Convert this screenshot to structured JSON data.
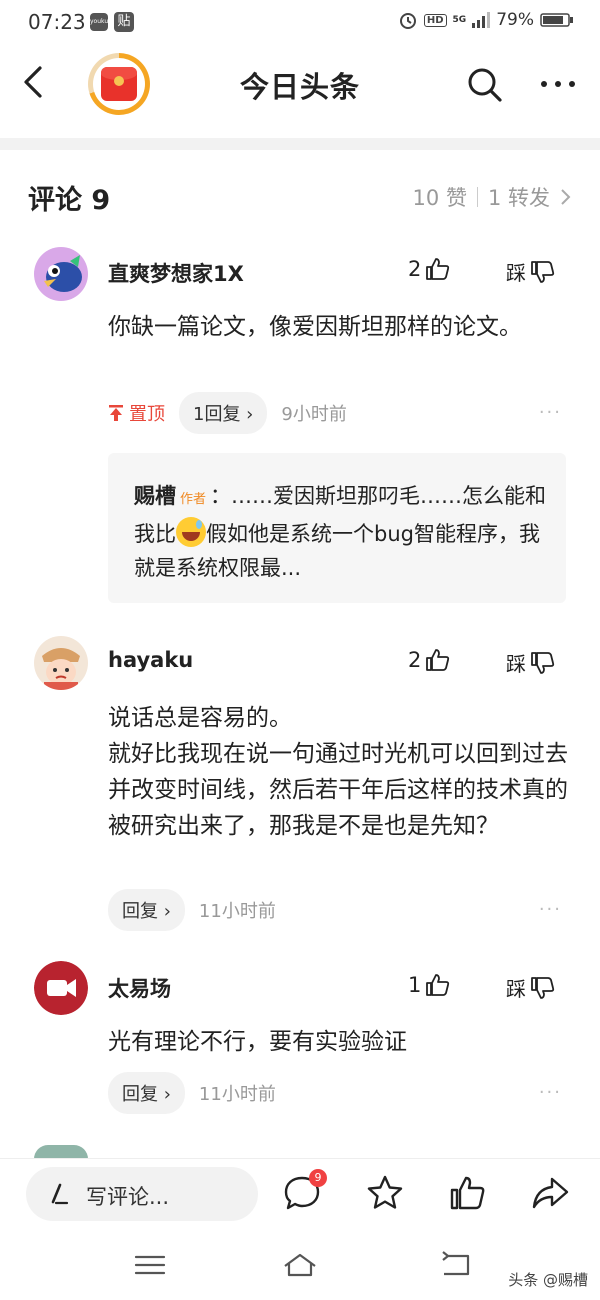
{
  "status_bar": {
    "time": "07:23",
    "app_icon_1": "youku",
    "app_icon_2": "贴",
    "hd": "HD",
    "network": "5G",
    "battery": "79%"
  },
  "nav": {
    "title": "今日头条"
  },
  "comments_header": {
    "title": "评论 9",
    "likes": "10 赞",
    "shares": "1 转发"
  },
  "comments": [
    {
      "user": "直爽梦想家1X",
      "likes": "2",
      "dislike": "踩",
      "text": "你缺一篇论文，像爱因斯坦那样的论文。",
      "pin": "置顶",
      "reply": "1回复",
      "time": "9小时前",
      "author_reply": {
        "name": "赐槽",
        "tag": "作者",
        "text_before": "：……爱因斯坦那叼毛……怎么能和我比",
        "text_after": "假如他是系统一个bug智能程序，我就是系统权限最..."
      }
    },
    {
      "user": "hayaku",
      "likes": "2",
      "dislike": "踩",
      "text": "说话总是容易的。\n就好比我现在说一句通过时光机可以回到过去并改变时间线，然后若干年后这样的技术真的被研究出来了，那我是不是也是先知？",
      "reply": "回复",
      "time": "11小时前"
    },
    {
      "user": "太易场",
      "likes": "1",
      "dislike": "踩",
      "text": "光有理论不行，要有实验验证",
      "reply": "回复",
      "time": "11小时前"
    }
  ],
  "bottom_bar": {
    "write_placeholder": "写评论...",
    "comment_badge": "9"
  },
  "watermark": "头条 @赐槽",
  "colors": {
    "pin_red": "#e8473a",
    "author_tag_orange": "#f08a24",
    "badge_red": "#f04142"
  }
}
